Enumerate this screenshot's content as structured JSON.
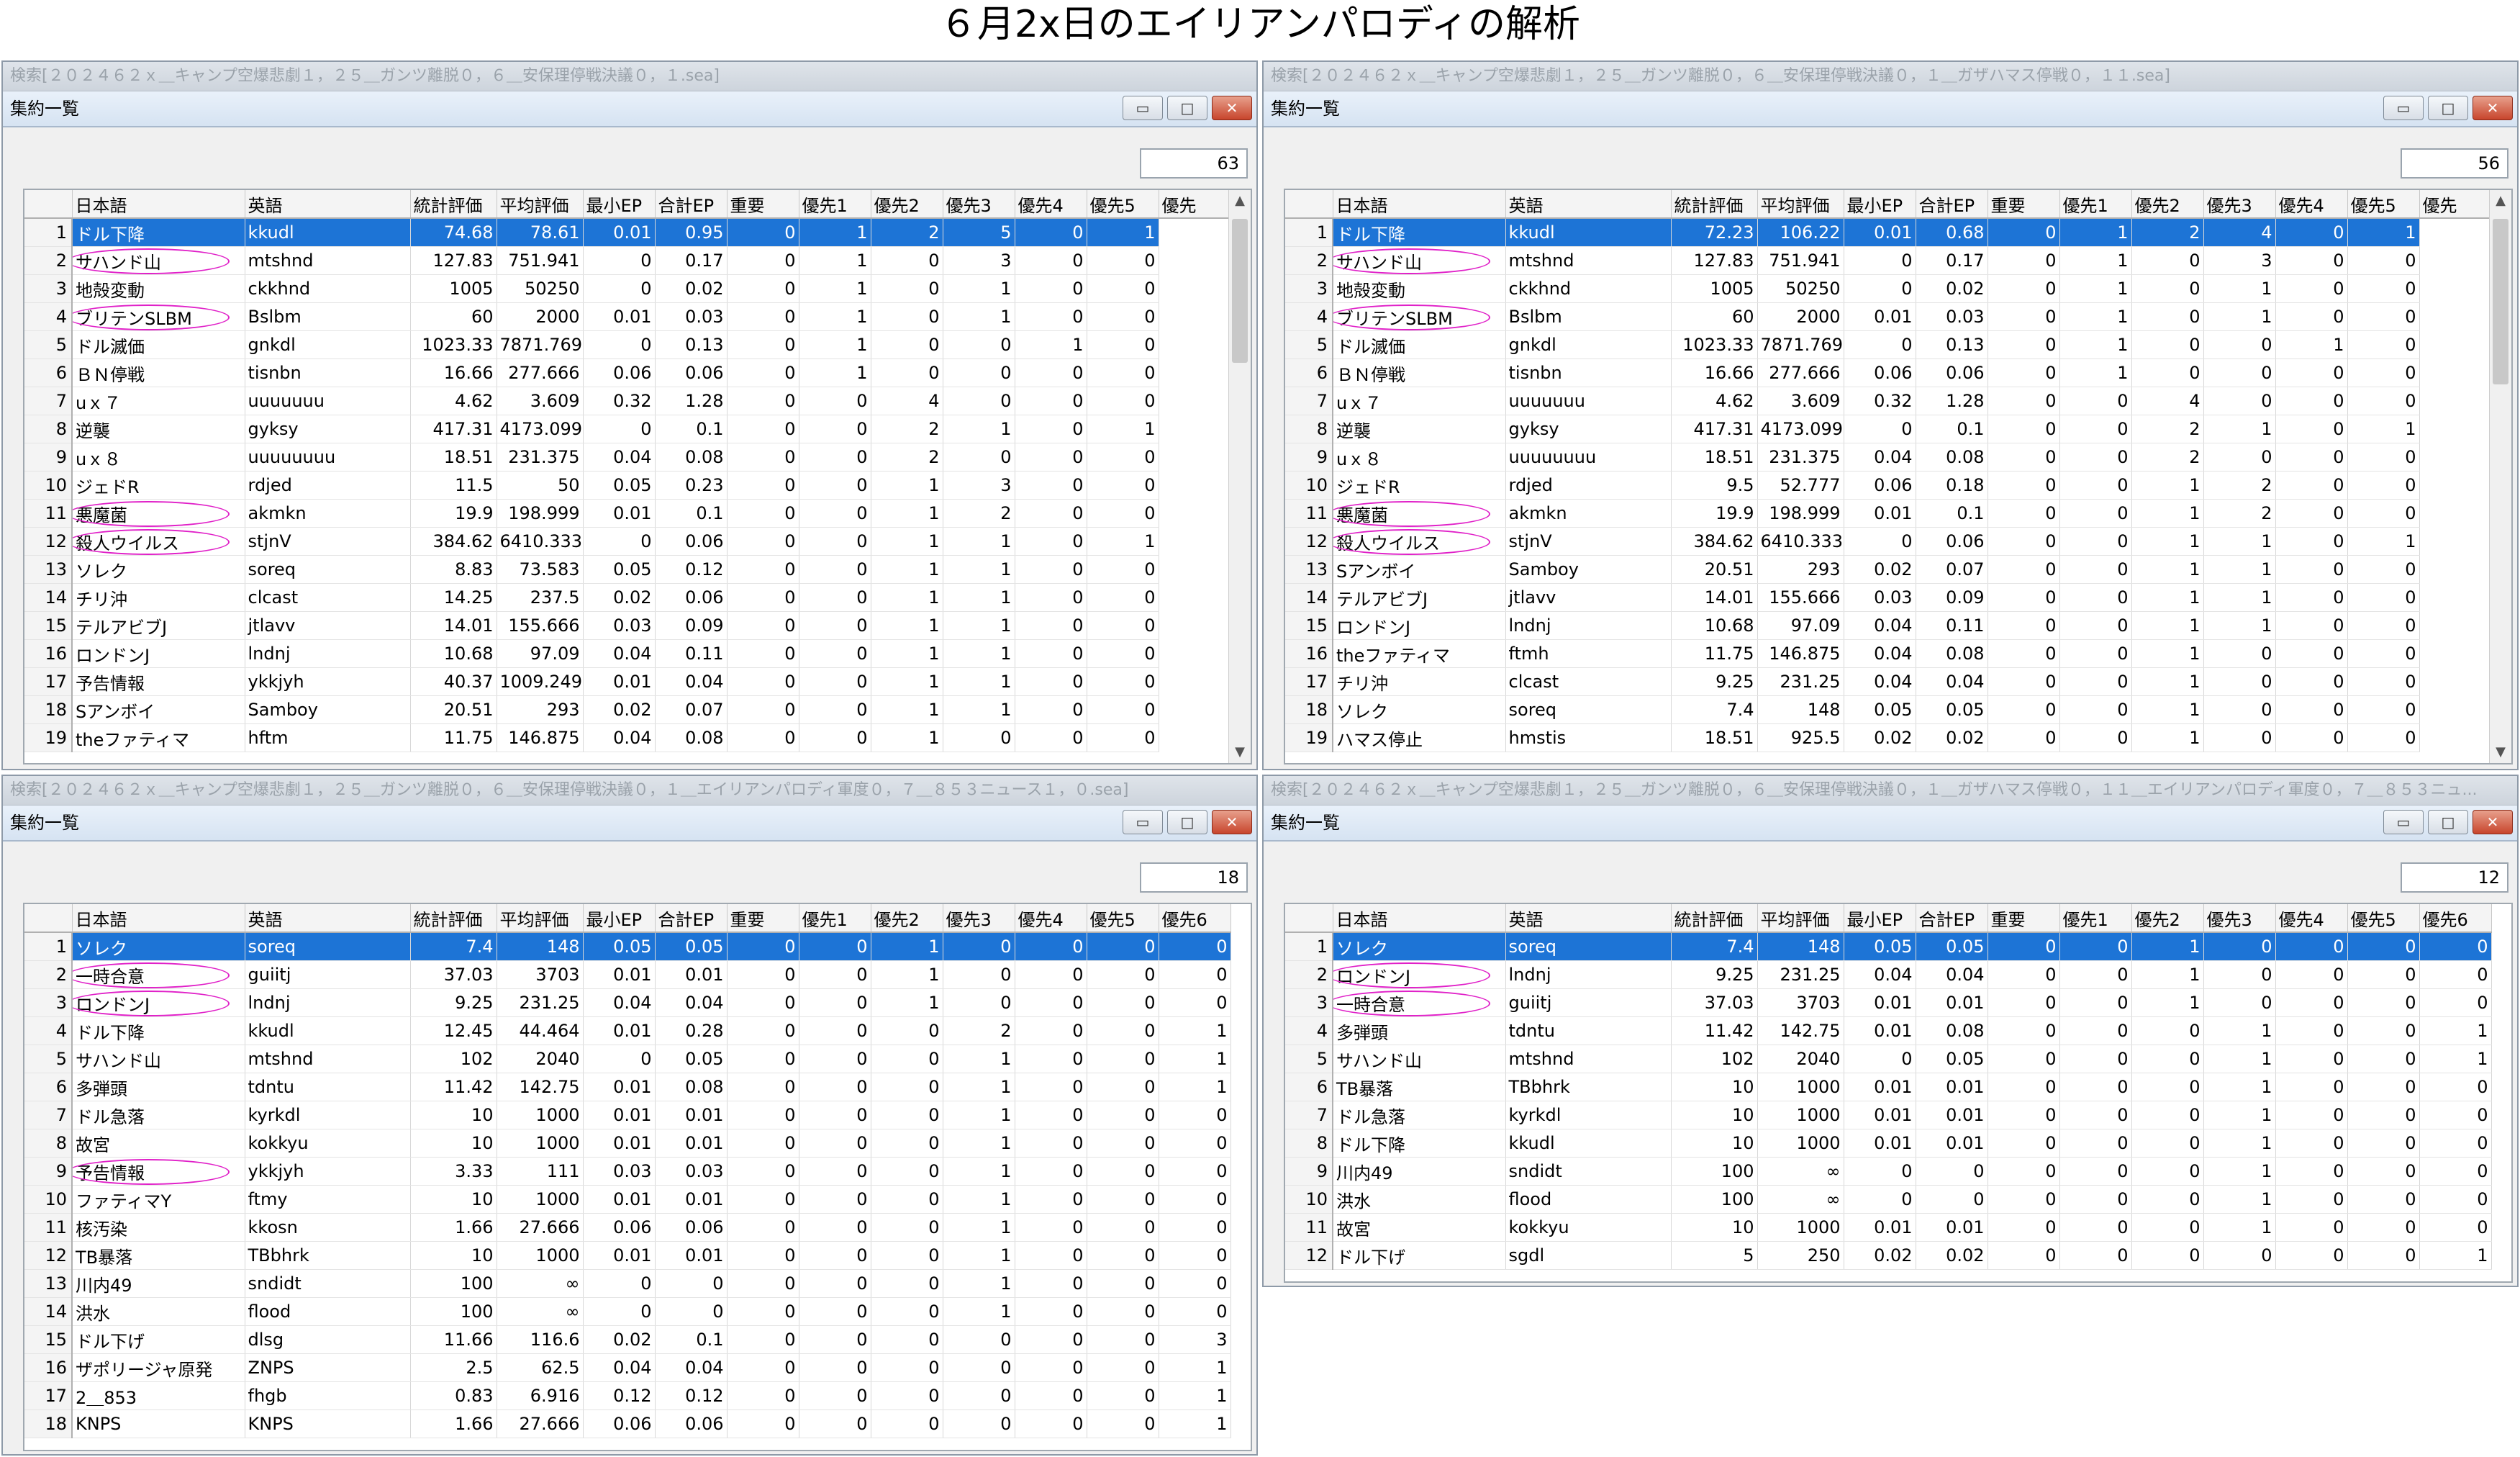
{
  "page_title": "６月2x日のエイリアンパロディの解析",
  "subwindow_title": "集約一覧",
  "columns_a": [
    "日本語",
    "英語",
    "統計評価",
    "平均評価",
    "最小EP",
    "合計EP",
    "重要",
    "優先1",
    "優先2",
    "優先3",
    "優先4",
    "優先5",
    "優先"
  ],
  "columns_b": [
    "日本語",
    "英語",
    "統計評価",
    "平均評価",
    "最小EP",
    "合計EP",
    "重要",
    "優先1",
    "優先2",
    "優先3",
    "優先4",
    "優先5",
    "優先6"
  ],
  "panels": [
    {
      "titlebar": "検索[２０２４６２ｘ＿キャンプ空爆悲劇１，２５＿ガンツ離脱０，６＿安保理停戦決議０，１.sea]",
      "count": "63",
      "rows": [
        [
          "1",
          "ドル下降",
          "kkudl",
          "74.68",
          "78.61",
          "0.01",
          "0.95",
          "0",
          "1",
          "2",
          "5",
          "0",
          "1"
        ],
        [
          "2",
          "サハンド山",
          "mtshnd",
          "127.83",
          "751.941",
          "0",
          "0.17",
          "0",
          "1",
          "0",
          "3",
          "0",
          "0"
        ],
        [
          "3",
          "地殻変動",
          "ckkhnd",
          "1005",
          "50250",
          "0",
          "0.02",
          "0",
          "1",
          "0",
          "1",
          "0",
          "0"
        ],
        [
          "4",
          "ブリテンSLBM",
          "Bslbm",
          "60",
          "2000",
          "0.01",
          "0.03",
          "0",
          "1",
          "0",
          "1",
          "0",
          "0"
        ],
        [
          "5",
          "ドル滅価",
          "gnkdl",
          "1023.33",
          "7871.769",
          "0",
          "0.13",
          "0",
          "1",
          "0",
          "0",
          "1",
          "0"
        ],
        [
          "6",
          "ＢＮ停戦",
          "tisnbn",
          "16.66",
          "277.666",
          "0.06",
          "0.06",
          "0",
          "1",
          "0",
          "0",
          "0",
          "0"
        ],
        [
          "7",
          "uｘ７",
          "uuuuuuu",
          "4.62",
          "3.609",
          "0.32",
          "1.28",
          "0",
          "0",
          "4",
          "0",
          "0",
          "0"
        ],
        [
          "8",
          "逆襲",
          "gyksy",
          "417.31",
          "4173.099",
          "0",
          "0.1",
          "0",
          "0",
          "2",
          "1",
          "0",
          "1"
        ],
        [
          "9",
          "uｘ８",
          "uuuuuuuu",
          "18.51",
          "231.375",
          "0.04",
          "0.08",
          "0",
          "0",
          "2",
          "0",
          "0",
          "0"
        ],
        [
          "10",
          "ジェドR",
          "rdjed",
          "11.5",
          "50",
          "0.05",
          "0.23",
          "0",
          "0",
          "1",
          "3",
          "0",
          "0"
        ],
        [
          "11",
          "悪魔菌",
          "akmkn",
          "19.9",
          "198.999",
          "0.01",
          "0.1",
          "0",
          "0",
          "1",
          "2",
          "0",
          "0"
        ],
        [
          "12",
          "殺人ウイルス",
          "stjnV",
          "384.62",
          "6410.333",
          "0",
          "0.06",
          "0",
          "0",
          "1",
          "1",
          "0",
          "1"
        ],
        [
          "13",
          "ソレク",
          "soreq",
          "8.83",
          "73.583",
          "0.05",
          "0.12",
          "0",
          "0",
          "1",
          "1",
          "0",
          "0"
        ],
        [
          "14",
          "チリ沖",
          "clcast",
          "14.25",
          "237.5",
          "0.02",
          "0.06",
          "0",
          "0",
          "1",
          "1",
          "0",
          "0"
        ],
        [
          "15",
          "テルアビブJ",
          "jtlavv",
          "14.01",
          "155.666",
          "0.03",
          "0.09",
          "0",
          "0",
          "1",
          "1",
          "0",
          "0"
        ],
        [
          "16",
          "ロンドンJ",
          "lndnj",
          "10.68",
          "97.09",
          "0.04",
          "0.11",
          "0",
          "0",
          "1",
          "1",
          "0",
          "0"
        ],
        [
          "17",
          "予告情報",
          "ykkjyh",
          "40.37",
          "1009.249",
          "0.01",
          "0.04",
          "0",
          "0",
          "1",
          "1",
          "0",
          "0"
        ],
        [
          "18",
          "Sアンボイ",
          "Samboy",
          "20.51",
          "293",
          "0.02",
          "0.07",
          "0",
          "0",
          "1",
          "1",
          "0",
          "0"
        ],
        [
          "19",
          "theファティマ",
          "hftm",
          "11.75",
          "146.875",
          "0.04",
          "0.08",
          "0",
          "0",
          "1",
          "0",
          "0",
          "0"
        ]
      ]
    },
    {
      "titlebar": "検索[２０２４６２ｘ＿キャンプ空爆悲劇１，２５＿ガンツ離脱０，６＿安保理停戦決議０，１＿ガザハマス停戦０，１１.sea]",
      "count": "56",
      "rows": [
        [
          "1",
          "ドル下降",
          "kkudl",
          "72.23",
          "106.22",
          "0.01",
          "0.68",
          "0",
          "1",
          "2",
          "4",
          "0",
          "1"
        ],
        [
          "2",
          "サハンド山",
          "mtshnd",
          "127.83",
          "751.941",
          "0",
          "0.17",
          "0",
          "1",
          "0",
          "3",
          "0",
          "0"
        ],
        [
          "3",
          "地殻変動",
          "ckkhnd",
          "1005",
          "50250",
          "0",
          "0.02",
          "0",
          "1",
          "0",
          "1",
          "0",
          "0"
        ],
        [
          "4",
          "ブリテンSLBM",
          "Bslbm",
          "60",
          "2000",
          "0.01",
          "0.03",
          "0",
          "1",
          "0",
          "1",
          "0",
          "0"
        ],
        [
          "5",
          "ドル滅価",
          "gnkdl",
          "1023.33",
          "7871.769",
          "0",
          "0.13",
          "0",
          "1",
          "0",
          "0",
          "1",
          "0"
        ],
        [
          "6",
          "ＢＮ停戦",
          "tisnbn",
          "16.66",
          "277.666",
          "0.06",
          "0.06",
          "0",
          "1",
          "0",
          "0",
          "0",
          "0"
        ],
        [
          "7",
          "uｘ７",
          "uuuuuuu",
          "4.62",
          "3.609",
          "0.32",
          "1.28",
          "0",
          "0",
          "4",
          "0",
          "0",
          "0"
        ],
        [
          "8",
          "逆襲",
          "gyksy",
          "417.31",
          "4173.099",
          "0",
          "0.1",
          "0",
          "0",
          "2",
          "1",
          "0",
          "1"
        ],
        [
          "9",
          "uｘ８",
          "uuuuuuuu",
          "18.51",
          "231.375",
          "0.04",
          "0.08",
          "0",
          "0",
          "2",
          "0",
          "0",
          "0"
        ],
        [
          "10",
          "ジェドR",
          "rdjed",
          "9.5",
          "52.777",
          "0.06",
          "0.18",
          "0",
          "0",
          "1",
          "2",
          "0",
          "0"
        ],
        [
          "11",
          "悪魔菌",
          "akmkn",
          "19.9",
          "198.999",
          "0.01",
          "0.1",
          "0",
          "0",
          "1",
          "2",
          "0",
          "0"
        ],
        [
          "12",
          "殺人ウイルス",
          "stjnV",
          "384.62",
          "6410.333",
          "0",
          "0.06",
          "0",
          "0",
          "1",
          "1",
          "0",
          "1"
        ],
        [
          "13",
          "Sアンボイ",
          "Samboy",
          "20.51",
          "293",
          "0.02",
          "0.07",
          "0",
          "0",
          "1",
          "1",
          "0",
          "0"
        ],
        [
          "14",
          "テルアビブJ",
          "jtlavv",
          "14.01",
          "155.666",
          "0.03",
          "0.09",
          "0",
          "0",
          "1",
          "1",
          "0",
          "0"
        ],
        [
          "15",
          "ロンドンJ",
          "lndnj",
          "10.68",
          "97.09",
          "0.04",
          "0.11",
          "0",
          "0",
          "1",
          "1",
          "0",
          "0"
        ],
        [
          "16",
          "theファティマ",
          "ftmh",
          "11.75",
          "146.875",
          "0.04",
          "0.08",
          "0",
          "0",
          "1",
          "0",
          "0",
          "0"
        ],
        [
          "17",
          "チリ沖",
          "clcast",
          "9.25",
          "231.25",
          "0.04",
          "0.04",
          "0",
          "0",
          "1",
          "0",
          "0",
          "0"
        ],
        [
          "18",
          "ソレク",
          "soreq",
          "7.4",
          "148",
          "0.05",
          "0.05",
          "0",
          "0",
          "1",
          "0",
          "0",
          "0"
        ],
        [
          "19",
          "ハマス停止",
          "hmstis",
          "18.51",
          "925.5",
          "0.02",
          "0.02",
          "0",
          "0",
          "1",
          "0",
          "0",
          "0"
        ]
      ]
    },
    {
      "titlebar": "検索[２０２４６２ｘ＿キャンプ空爆悲劇１，２５＿ガンツ離脱０，６＿安保理停戦決議０，１＿エイリアンパロディ軍度０，７＿８５３ニュース１，０.sea]",
      "count": "18",
      "rows": [
        [
          "1",
          "ソレク",
          "soreq",
          "7.4",
          "148",
          "0.05",
          "0.05",
          "0",
          "0",
          "1",
          "0",
          "0",
          "0",
          "0"
        ],
        [
          "2",
          "一時合意",
          "guiitj",
          "37.03",
          "3703",
          "0.01",
          "0.01",
          "0",
          "0",
          "1",
          "0",
          "0",
          "0",
          "0"
        ],
        [
          "3",
          "ロンドンJ",
          "lndnj",
          "9.25",
          "231.25",
          "0.04",
          "0.04",
          "0",
          "0",
          "1",
          "0",
          "0",
          "0",
          "0"
        ],
        [
          "4",
          "ドル下降",
          "kkudl",
          "12.45",
          "44.464",
          "0.01",
          "0.28",
          "0",
          "0",
          "0",
          "2",
          "0",
          "0",
          "1"
        ],
        [
          "5",
          "サハンド山",
          "mtshnd",
          "102",
          "2040",
          "0",
          "0.05",
          "0",
          "0",
          "0",
          "1",
          "0",
          "0",
          "1"
        ],
        [
          "6",
          "多弾頭",
          "tdntu",
          "11.42",
          "142.75",
          "0.01",
          "0.08",
          "0",
          "0",
          "0",
          "1",
          "0",
          "0",
          "1"
        ],
        [
          "7",
          "ドル急落",
          "kyrkdl",
          "10",
          "1000",
          "0.01",
          "0.01",
          "0",
          "0",
          "0",
          "1",
          "0",
          "0",
          "0"
        ],
        [
          "8",
          "故宮",
          "kokkyu",
          "10",
          "1000",
          "0.01",
          "0.01",
          "0",
          "0",
          "0",
          "1",
          "0",
          "0",
          "0"
        ],
        [
          "9",
          "予告情報",
          "ykkjyh",
          "3.33",
          "111",
          "0.03",
          "0.03",
          "0",
          "0",
          "0",
          "1",
          "0",
          "0",
          "0"
        ],
        [
          "10",
          "ファティマY",
          "ftmy",
          "10",
          "1000",
          "0.01",
          "0.01",
          "0",
          "0",
          "0",
          "1",
          "0",
          "0",
          "0"
        ],
        [
          "11",
          "核汚染",
          "kkosn",
          "1.66",
          "27.666",
          "0.06",
          "0.06",
          "0",
          "0",
          "0",
          "1",
          "0",
          "0",
          "0"
        ],
        [
          "12",
          "TB暴落",
          "TBbhrk",
          "10",
          "1000",
          "0.01",
          "0.01",
          "0",
          "0",
          "0",
          "1",
          "0",
          "0",
          "0"
        ],
        [
          "13",
          "川内49",
          "sndidt",
          "100",
          "∞",
          "0",
          "0",
          "0",
          "0",
          "0",
          "1",
          "0",
          "0",
          "0"
        ],
        [
          "14",
          "洪水",
          "flood",
          "100",
          "∞",
          "0",
          "0",
          "0",
          "0",
          "0",
          "1",
          "0",
          "0",
          "0"
        ],
        [
          "15",
          "ドル下げ",
          "dlsg",
          "11.66",
          "116.6",
          "0.02",
          "0.1",
          "0",
          "0",
          "0",
          "0",
          "0",
          "0",
          "3"
        ],
        [
          "16",
          "ザポリージャ原発",
          "ZNPS",
          "2.5",
          "62.5",
          "0.04",
          "0.04",
          "0",
          "0",
          "0",
          "0",
          "0",
          "0",
          "1"
        ],
        [
          "17",
          "2＿853",
          "fhgb",
          "0.83",
          "6.916",
          "0.12",
          "0.12",
          "0",
          "0",
          "0",
          "0",
          "0",
          "0",
          "1"
        ],
        [
          "18",
          "KNPS",
          "KNPS",
          "1.66",
          "27.666",
          "0.06",
          "0.06",
          "0",
          "0",
          "0",
          "0",
          "0",
          "0",
          "1"
        ]
      ]
    },
    {
      "titlebar": "検索[２０２４６２ｘ＿キャンプ空爆悲劇１，２５＿ガンツ離脱０，６＿安保理停戦決議０，１＿ガザハマス停戦０，１１＿エイリアンパロディ軍度０，７＿８５３ニュ...",
      "count": "12",
      "rows": [
        [
          "1",
          "ソレク",
          "soreq",
          "7.4",
          "148",
          "0.05",
          "0.05",
          "0",
          "0",
          "1",
          "0",
          "0",
          "0",
          "0"
        ],
        [
          "2",
          "ロンドンJ",
          "lndnj",
          "9.25",
          "231.25",
          "0.04",
          "0.04",
          "0",
          "0",
          "1",
          "0",
          "0",
          "0",
          "0"
        ],
        [
          "3",
          "一時合意",
          "guiitj",
          "37.03",
          "3703",
          "0.01",
          "0.01",
          "0",
          "0",
          "1",
          "0",
          "0",
          "0",
          "0"
        ],
        [
          "4",
          "多弾頭",
          "tdntu",
          "11.42",
          "142.75",
          "0.01",
          "0.08",
          "0",
          "0",
          "0",
          "1",
          "0",
          "0",
          "1"
        ],
        [
          "5",
          "サハンド山",
          "mtshnd",
          "102",
          "2040",
          "0",
          "0.05",
          "0",
          "0",
          "0",
          "1",
          "0",
          "0",
          "1"
        ],
        [
          "6",
          "TB暴落",
          "TBbhrk",
          "10",
          "1000",
          "0.01",
          "0.01",
          "0",
          "0",
          "0",
          "1",
          "0",
          "0",
          "0"
        ],
        [
          "7",
          "ドル急落",
          "kyrkdl",
          "10",
          "1000",
          "0.01",
          "0.01",
          "0",
          "0",
          "0",
          "1",
          "0",
          "0",
          "0"
        ],
        [
          "8",
          "ドル下降",
          "kkudl",
          "10",
          "1000",
          "0.01",
          "0.01",
          "0",
          "0",
          "0",
          "1",
          "0",
          "0",
          "0"
        ],
        [
          "9",
          "川内49",
          "sndidt",
          "100",
          "∞",
          "0",
          "0",
          "0",
          "0",
          "0",
          "1",
          "0",
          "0",
          "0"
        ],
        [
          "10",
          "洪水",
          "flood",
          "100",
          "∞",
          "0",
          "0",
          "0",
          "0",
          "0",
          "1",
          "0",
          "0",
          "0"
        ],
        [
          "11",
          "故宮",
          "kokkyu",
          "10",
          "1000",
          "0.01",
          "0.01",
          "0",
          "0",
          "0",
          "1",
          "0",
          "0",
          "0"
        ],
        [
          "12",
          "ドル下げ",
          "sgdl",
          "5",
          "250",
          "0.02",
          "0.02",
          "0",
          "0",
          "0",
          "0",
          "0",
          "0",
          "1"
        ]
      ]
    }
  ],
  "window_buttons": {
    "minimize": "▭",
    "maximize": "□",
    "close": "✕"
  },
  "highlight_color": "#e020c8",
  "selection_color": "#1d74d6"
}
